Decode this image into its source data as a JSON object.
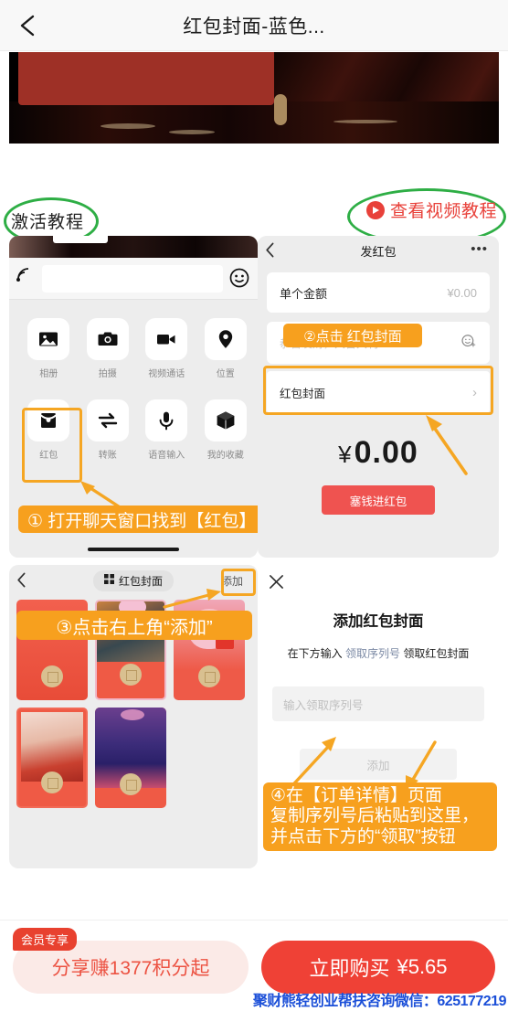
{
  "header": {
    "title": "红包封面-蓝色...",
    "back_icon": "chevron-left-icon"
  },
  "tutorial": {
    "section_label": "激活教程",
    "video_link_label": "查看视频教程",
    "video_icon": "play-circle-icon"
  },
  "panel_chat": {
    "voice_icon": "voice-wave-icon",
    "emoji_icon": "smiley-icon",
    "grid_row1": [
      {
        "label": "相册",
        "icon": "photo-icon"
      },
      {
        "label": "拍摄",
        "icon": "camera-icon"
      },
      {
        "label": "视频通话",
        "icon": "video-camera-icon"
      },
      {
        "label": "位置",
        "icon": "location-pin-icon"
      }
    ],
    "grid_row2": [
      {
        "label": "红包",
        "icon": "red-packet-icon"
      },
      {
        "label": "转账",
        "icon": "transfer-arrows-icon"
      },
      {
        "label": "语音输入",
        "icon": "microphone-icon"
      },
      {
        "label": "我的收藏",
        "icon": "box-icon"
      }
    ],
    "step_label": "① 打开聊天窗口找到【红包】"
  },
  "panel_send": {
    "nav_title": "发红包",
    "back_icon": "chevron-left-icon",
    "more_icon": "ellipsis-icon",
    "amount_row_label": "单个金额",
    "amount_row_value": "¥0.00",
    "wish_placeholder": "恭喜发财，大吉大利",
    "wish_emoji_icon": "smiley-plus-icon",
    "cover_row_label": "红包封面",
    "cover_row_chevron": "chevron-right-icon",
    "total_currency": "¥",
    "total_amount": "0.00",
    "submit_label": "塞钱进红包",
    "step_label": "②点击 红包封面"
  },
  "panel_gallery": {
    "back_icon": "chevron-left-icon",
    "nav_pill_icon": "grid-icon",
    "nav_pill_label": "红包封面",
    "add_button_label": "添加",
    "step_label": "③点击右上角“添加”",
    "covers": [
      {
        "name": "plain-red-cover"
      },
      {
        "name": "couple-photo-cover"
      },
      {
        "name": "pink-cat-cover"
      },
      {
        "name": "anime-boy-cover"
      },
      {
        "name": "purple-castle-cover"
      }
    ]
  },
  "panel_add_dialog": {
    "close_icon": "close-x-icon",
    "title": "添加红包封面",
    "subtitle_prefix": "在下方输入 ",
    "subtitle_highlight": "领取序列号",
    "subtitle_suffix": " 领取红包封面",
    "input_placeholder": "输入领取序列号",
    "input_value": "",
    "submit_label": "添加",
    "step_label_line1": "④在【订单详情】页面",
    "step_label_line2": "复制序列号后粘贴到这里，",
    "step_label_line3": "并点击下方的“领取”按钮"
  },
  "bottom_bar": {
    "member_badge": "会员专享",
    "share_label": "分享赚1377积分起",
    "buy_label": "立即购买",
    "buy_price": "¥5.65"
  },
  "watermark": {
    "text": "聚财熊轻创业帮扶咨询微信：625177219"
  },
  "colors": {
    "accent_red": "#ef4136",
    "annotation_orange": "#f7a01e",
    "annotation_green": "#2eae45",
    "watermark_blue": "#1b4fd8"
  }
}
